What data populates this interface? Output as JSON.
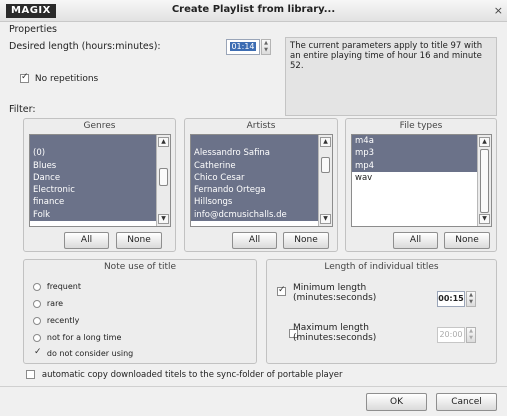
{
  "window": {
    "logo": "MAGIX",
    "title": "Create Playlist from library...",
    "close_glyph": "×"
  },
  "properties": {
    "heading": "Properties",
    "desired_length_label": "Desired length (hours:minutes):",
    "desired_length_value": "01:14",
    "info_text": "The current parameters apply to title 97 with an entire playing time of hour 16 and minute 52.",
    "no_repetitions_label": "No repetitions",
    "no_repetitions_checked": true
  },
  "filter": {
    "heading": "Filter:",
    "genres": {
      "title": "Genres",
      "items": [
        "(0)",
        "Blues",
        "Dance",
        "Electronic",
        "finance",
        "Folk"
      ],
      "all_label": "All",
      "none_label": "None"
    },
    "artists": {
      "title": "Artists",
      "items": [
        "",
        "Alessandro Safina",
        "Catherine",
        "Chico Cesar",
        "Fernando Ortega",
        "Hillsongs",
        "info@dcmusichalls.de"
      ],
      "all_label": "All",
      "none_label": "None"
    },
    "file_types": {
      "title": "File types",
      "items": [
        "m4a",
        "mp3",
        "mp4",
        "wav"
      ],
      "selected": [
        "m4a",
        "mp3",
        "mp4"
      ],
      "all_label": "All",
      "none_label": "None"
    }
  },
  "note_use": {
    "title": "Note use of title",
    "options": [
      "frequent",
      "rare",
      "recently",
      "not for a long time"
    ],
    "do_not_consider_label": "do not consider using",
    "do_not_consider_checked": true
  },
  "length_individual": {
    "title": "Length of individual titles",
    "min_label": "Minimum length (minutes:seconds)",
    "min_checked": true,
    "min_value": "00:15",
    "max_label": "Maximum length (minutes:seconds)",
    "max_checked": false,
    "max_value": "20:00"
  },
  "auto_copy": {
    "label": "automatic copy downloaded titels to the sync-folder of portable player",
    "checked": false
  },
  "buttons": {
    "ok": "OK",
    "cancel": "Cancel"
  }
}
